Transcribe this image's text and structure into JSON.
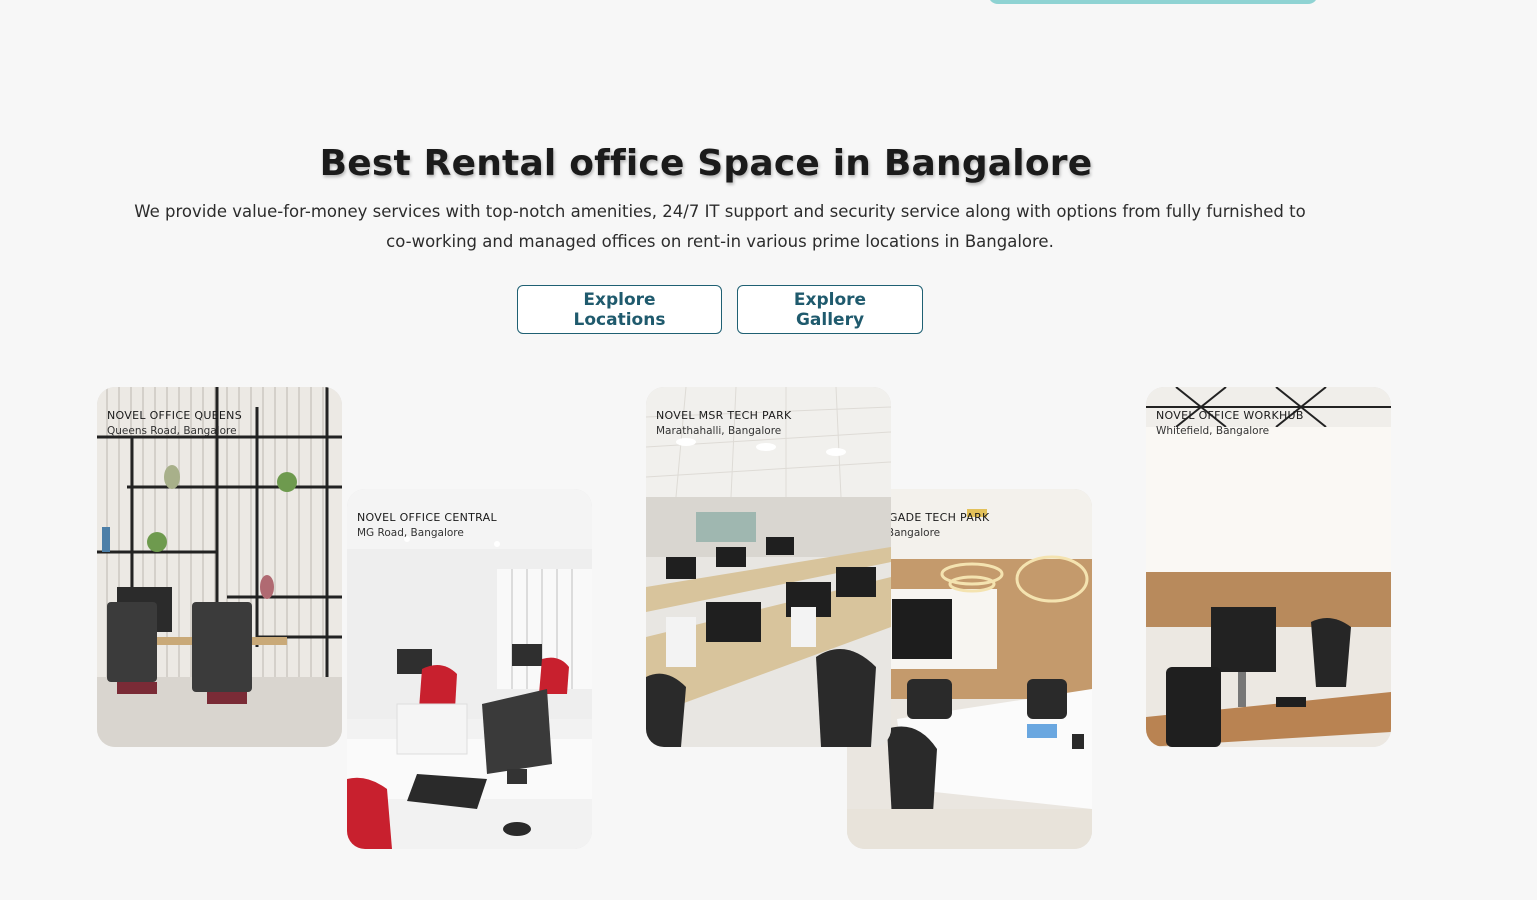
{
  "section": {
    "title": "Best Rental office Space in Bangalore",
    "description": "We provide value-for-money services with top-notch amenities, 24/7 IT support and security service along with options from fully furnished to co-working and managed offices on rent-in various prime locations in Bangalore."
  },
  "buttons": {
    "explore_locations": "Explore Locations",
    "explore_gallery": "Explore Gallery"
  },
  "cards": [
    {
      "name": "NOVEL OFFICE QUEENS",
      "location": "Queens Road, Bangalore"
    },
    {
      "name": "NOVEL OFFICE CENTRAL",
      "location": "MG Road, Bangalore"
    },
    {
      "name": "NOVEL MSR TECH PARK",
      "location": "Marathahalli, Bangalore"
    },
    {
      "name": "NOVEL BRIGADE TECH PARK",
      "location": "Whitefield, Bangalore"
    },
    {
      "name": "NOVEL OFFICE WORKHUB",
      "location": "Whitefield, Bangalore"
    }
  ],
  "colors": {
    "background": "#f7f7f7",
    "button_text": "#1f5a6d",
    "button_border": "#1f6073",
    "accent": "#8fd3d3"
  }
}
